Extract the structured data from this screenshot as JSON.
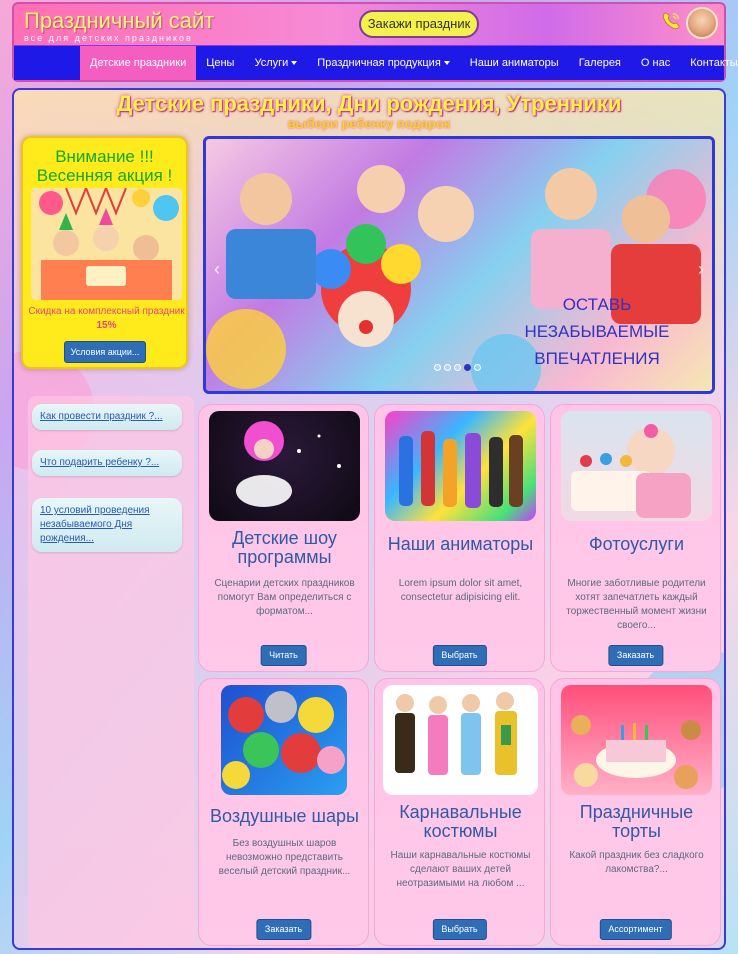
{
  "header": {
    "site_title": "Праздничный сайт",
    "site_subtitle": "все для детских праздников",
    "order_button": "Закажи праздник"
  },
  "nav": {
    "items": [
      {
        "label": "Детские праздники",
        "active": true,
        "dropdown": false
      },
      {
        "label": "Цены",
        "active": false,
        "dropdown": false
      },
      {
        "label": "Услуги",
        "active": false,
        "dropdown": true
      },
      {
        "label": "Праздничная продукция",
        "active": false,
        "dropdown": true
      },
      {
        "label": "Наши аниматоры",
        "active": false,
        "dropdown": false
      },
      {
        "label": "Галерея",
        "active": false,
        "dropdown": false
      },
      {
        "label": "О нас",
        "active": false,
        "dropdown": false
      },
      {
        "label": "Контакты",
        "active": false,
        "dropdown": false
      }
    ]
  },
  "hero": {
    "title": "Детские праздники, Дни рождения, Утренники",
    "subtitle": "выбери ребенку подарок"
  },
  "promo": {
    "title_line1": "Внимание !!!",
    "title_line2": "Весенняя акция !",
    "text": "Скидка на комплексный праздник",
    "percent": "15%",
    "button": "Условия акции..."
  },
  "slider": {
    "caption_line1": "ОСТАВЬ",
    "caption_line2": "НЕЗАБЫВАЕМЫЕ",
    "caption_line3": "ВПЕЧАТЛЕНИЯ",
    "dot_count": 5,
    "active_dot": 4
  },
  "sidebar": {
    "links": [
      "Как провести праздник ?...",
      "Что подарить ребенку ?...",
      "10 условий проведения незабываемого Дня рождения..."
    ]
  },
  "cards": [
    {
      "title": "Детские шоу программы",
      "text": "Сценарии детских праздников помогут Вам определиться с форматом...",
      "button": "Читать",
      "icon": "clown-show-image"
    },
    {
      "title": "Наши аниматоры",
      "text": "Lorem ipsum dolor sit amet, consectetur adipisicing elit.",
      "button": "Выбрать",
      "icon": "animators-image"
    },
    {
      "title": "Фотоуслуги",
      "text": "Многие заботливые родители хотят запечатлеть каждый торжественный момент жизни своего...",
      "button": "Заказать",
      "icon": "baby-cake-image"
    },
    {
      "title": "Воздушные шары",
      "text": "Без воздушных шаров невозможно представить веселый детский праздник...",
      "button": "Заказать",
      "icon": "balloons-image"
    },
    {
      "title": "Карнавальные костюмы",
      "text": "Наши карнавальные костюмы сделают ваших детей неотразимыми на любом ...",
      "button": "Выбрать",
      "icon": "costumes-image"
    },
    {
      "title": "Праздничные торты",
      "text": "Какой праздник без сладкого лакомства?...",
      "button": "Ассортимент",
      "icon": "cakes-image"
    }
  ],
  "colors": {
    "nav_bg": "#1f19e8",
    "nav_active": "#f45ec0",
    "button_blue": "#2f6db6",
    "title_yellow": "#fff23c",
    "promo_yellow": "#ffea1c"
  }
}
